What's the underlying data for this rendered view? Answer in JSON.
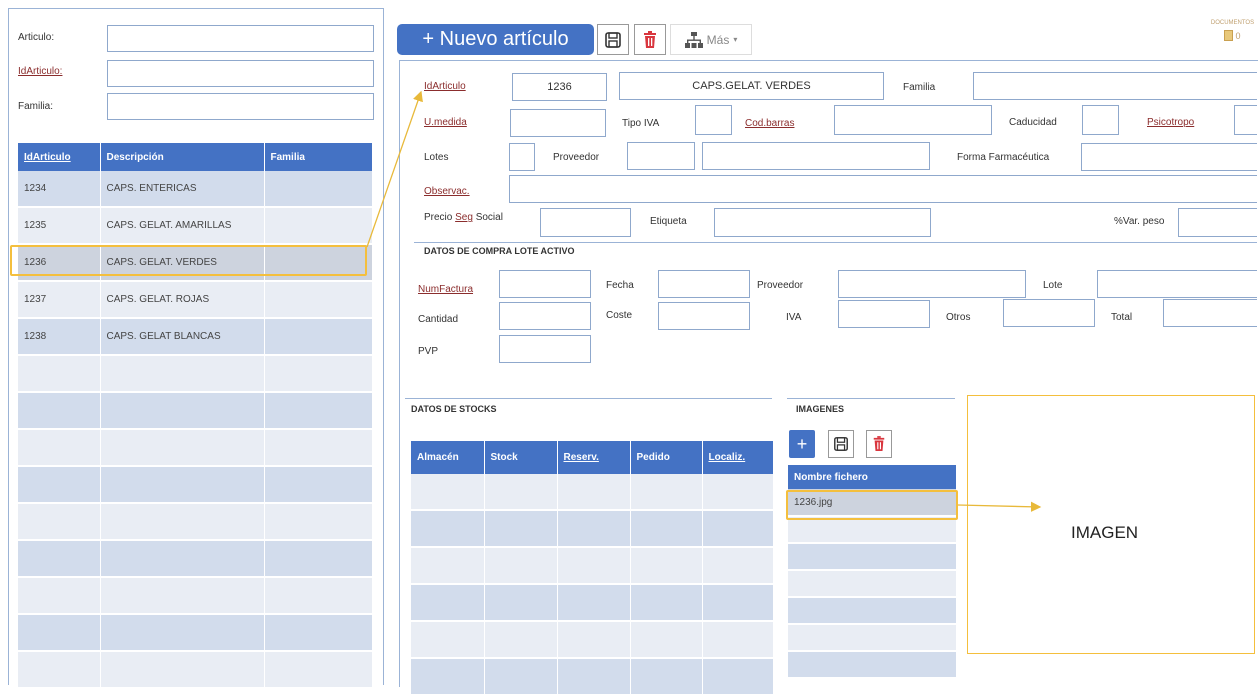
{
  "search": {
    "articulo_label": "Articulo:",
    "idarticulo_label": "IdArticulo:",
    "familia_label": "Familia:"
  },
  "list": {
    "columns": [
      "IdArticulo",
      "Descripción",
      "Familia"
    ],
    "rows": [
      {
        "id": "1234",
        "desc": "CAPS. ENTERICAS",
        "fam": ""
      },
      {
        "id": "1235",
        "desc": "CAPS. GELAT. AMARILLAS",
        "fam": ""
      },
      {
        "id": "1236",
        "desc": "CAPS. GELAT. VERDES",
        "fam": ""
      },
      {
        "id": "1237",
        "desc": "CAPS. GELAT. ROJAS",
        "fam": ""
      },
      {
        "id": "1238",
        "desc": "CAPS. GELAT BLANCAS",
        "fam": ""
      }
    ],
    "selected_id": "1236"
  },
  "toolbar": {
    "new_label": "+ Nuevo artículo",
    "more_label": "Más",
    "documents_label": "DOCUMENTOS",
    "documents_count": "0"
  },
  "form": {
    "idarticulo_label": "IdArticulo",
    "idarticulo_value": "1236",
    "descripcion_value": "CAPS.GELAT. VERDES",
    "familia_label": "Familia",
    "umedida_label": "U.medida",
    "tipo_iva_label": "Tipo IVA",
    "cod_barras_label": "Cod.barras",
    "caducidad_label": "Caducidad",
    "psicotropo_label": "Psicotropo",
    "lotes_label": "Lotes",
    "proveedor_label": "Proveedor",
    "forma_label": "Forma Farmacéutica",
    "observac_label": "Observac.",
    "precio_label": "Precio Seg Social",
    "etiqueta_label": "Etiqueta",
    "var_peso_label": "%Var. peso"
  },
  "compra": {
    "section_title": "DATOS DE COMPRA LOTE ACTIVO",
    "numfactura_label": "NumFactura",
    "fecha_label": "Fecha",
    "proveedor_label": "Proveedor",
    "lote_label": "Lote",
    "cantidad_label": "Cantidad",
    "coste_label": "Coste",
    "iva_label": "IVA",
    "otros_label": "Otros",
    "total_label": "Total",
    "pvp_label": "PVP"
  },
  "stocks": {
    "section_title": "DATOS DE STOCKS",
    "columns": [
      "Almacén",
      "Stock",
      "Reserv.",
      "Pedido",
      "Localiz."
    ]
  },
  "imagenes": {
    "section_title": "IMAGENES",
    "column": "Nombre fichero",
    "files": [
      "1236.jpg"
    ],
    "preview_label": "IMAGEN"
  },
  "colors": {
    "accent": "#4472c4",
    "highlight": "#f4bf3d",
    "delete": "#d9363e"
  }
}
